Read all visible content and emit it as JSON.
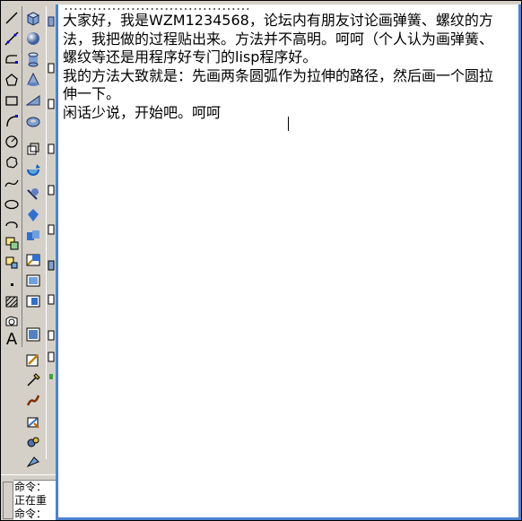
{
  "toolbar_left": [
    {
      "icon": "line-icon"
    },
    {
      "icon": "construction-line-icon"
    },
    {
      "icon": "polyline-icon"
    },
    {
      "icon": "polygon-icon"
    },
    {
      "icon": "rectangle-icon"
    },
    {
      "icon": "arc-icon"
    },
    {
      "icon": "circle-icon"
    },
    {
      "icon": "revision-cloud-icon"
    },
    {
      "icon": "spline-icon"
    },
    {
      "icon": "ellipse-icon"
    },
    {
      "icon": "ellipse-arc-icon"
    },
    {
      "icon": "insert-block-icon"
    },
    {
      "icon": "make-block-icon"
    },
    {
      "icon": "point-icon"
    },
    {
      "icon": "hatch-icon"
    },
    {
      "icon": "region-icon"
    },
    {
      "icon": "multiline-text-icon",
      "glyph": "A"
    }
  ],
  "toolbar_solids": [
    {
      "icon": "box-icon"
    },
    {
      "icon": "sphere-icon"
    },
    {
      "icon": "cylinder-icon"
    },
    {
      "icon": "cone-icon"
    },
    {
      "icon": "wedge-icon"
    },
    {
      "icon": "torus-icon"
    },
    {
      "icon": "extrude-icon"
    },
    {
      "icon": "revolve-icon"
    },
    {
      "icon": "slice-icon"
    },
    {
      "icon": "section-icon"
    },
    {
      "icon": "interference-icon"
    },
    {
      "icon": "setup-drawing-icon"
    },
    {
      "icon": "setup-view-icon"
    },
    {
      "icon": "setup-profile-icon"
    },
    {
      "icon": "render-icon"
    },
    {
      "icon": "scene-icon"
    },
    {
      "icon": "light-icon"
    },
    {
      "icon": "materials-icon"
    },
    {
      "icon": "mapping-icon"
    },
    {
      "icon": "background-icon"
    },
    {
      "icon": "fog-icon"
    }
  ],
  "document": {
    "header_fragment": "…………………………………",
    "paragraphs": [
      "大家好，我是WZM1234568，论坛内有朋友讨论画弹簧、螺纹的方法，我把做的过程贴出来。方法并不高明。呵呵（个人认为画弹簧、螺纹等还是用程序好专门的lisp程序好。",
      "我的方法大致就是：先画两条圆弧作为拉伸的路径，然后画一个圆拉伸一下。",
      "闲话少说，开始吧。呵呵"
    ]
  },
  "command_line": {
    "lines": [
      "命令：",
      "正在重",
      "命令："
    ]
  },
  "colors": {
    "window_border": "#4a82d0",
    "toolbar_bg": "#d4d0c8",
    "text": "#000000"
  }
}
